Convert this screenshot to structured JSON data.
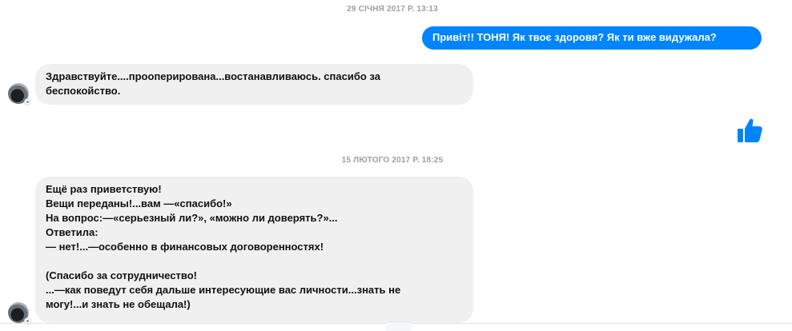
{
  "conversation": {
    "timestamps": [
      "29 СІЧНЯ 2017 Р. 13:13",
      "15 ЛЮТОГО 2017 Р. 18:25"
    ],
    "messages": [
      {
        "direction": "outgoing",
        "text": "Привіт!! ТОНЯ! Як твоє здоровя? Як ти вже видужала?"
      },
      {
        "direction": "incoming",
        "lines": [
          "Здравствуйте....прооперирована...востанавливаюсь. спасибо за",
          "беспокойство."
        ]
      },
      {
        "direction": "outgoing",
        "icon": "thumbs-up-icon"
      },
      {
        "direction": "incoming",
        "lines": [
          "Ещё раз приветствую!",
          "Вещи переданы!...вам —«спасибо!»",
          "На вопрос:—«серьезный ли?», «можно ли доверять?»...",
          "Ответила:",
          "— нет!...—особенно в финансовых договоренностях!",
          "",
          "(Спасибо за сотрудничество!",
          "...—как поведут себя дальше интересующие вас личности...знать не",
          "могу!...и знать не обещала!)"
        ]
      }
    ]
  },
  "colors": {
    "outgoing_bubble": "#0084ff",
    "incoming_bubble": "#f1f0f0",
    "timestamp_text": "#9b9ea3",
    "like_icon": "#0084ff"
  }
}
